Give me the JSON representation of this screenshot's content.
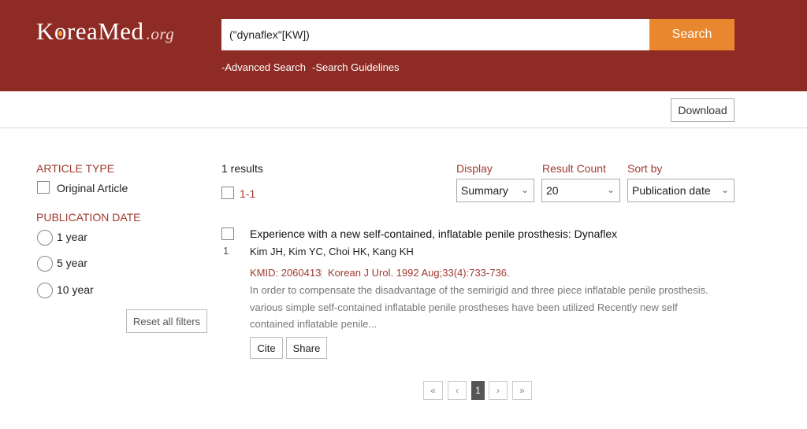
{
  "header": {
    "logo_text_1": "K",
    "logo_text_2": "reaMed",
    "logo_suffix": ".org",
    "search_value": "(\"dynaflex\"[KW])",
    "search_button": "Search",
    "links": [
      "-Advanced Search",
      "-Search Guidelines"
    ]
  },
  "toolbar": {
    "download_label": "Download"
  },
  "filters": {
    "article_type_title": "ARTICLE TYPE",
    "article_types": [
      "Original Article"
    ],
    "publication_date_title": "PUBLICATION DATE",
    "publication_dates": [
      "1 year",
      "5 year",
      "10 year"
    ],
    "reset_label": "Reset all filters"
  },
  "results_header": {
    "count_text": "1 results",
    "range_text": "1-1",
    "display_label": "Display",
    "display_value": "Summary",
    "result_count_label": "Result Count",
    "result_count_value": "20",
    "sort_label": "Sort by",
    "sort_value": "Publication date"
  },
  "results": [
    {
      "index": "1",
      "title": "Experience with a new self-contained, inflatable penile prosthesis: Dynaflex",
      "authors": "Kim JH, Kim YC, Choi HK, Kang KH",
      "kmid": "KMID: 2060413",
      "citation": "Korean J Urol.  1992 Aug;33(4):733-736.",
      "abstract": "In order to compensate the disadvantage of the semirigid and three piece inflatable penile prosthesis. various simple self-contained inflatable penile prostheses have been utilized Recently new self contained inflatable penile...",
      "cite_label": "Cite",
      "share_label": "Share"
    }
  ],
  "pagination": {
    "first_icon": "«",
    "prev_icon": "‹",
    "current": "1",
    "next_icon": "›",
    "last_icon": "»"
  },
  "colors": {
    "header_bg": "#8e2b24",
    "search_button": "#e9872f",
    "accent_text": "#a23a30"
  }
}
